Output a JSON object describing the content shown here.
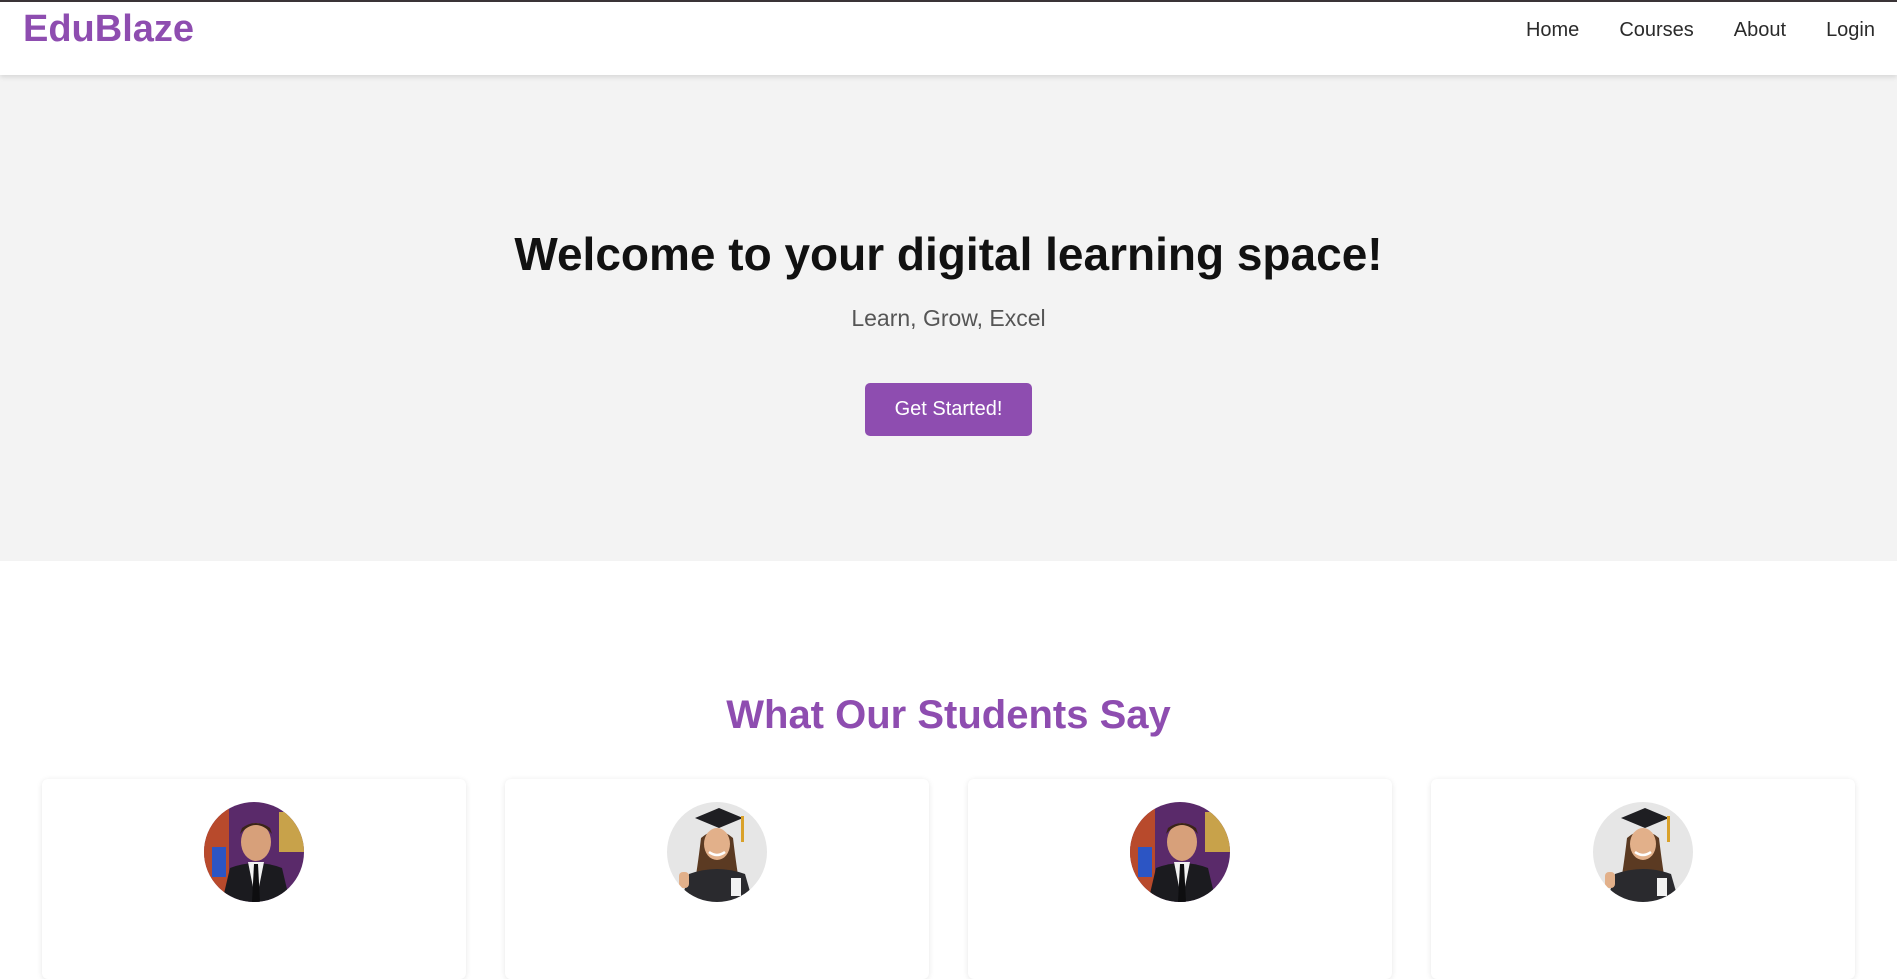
{
  "header": {
    "brand": "EduBlaze",
    "nav": {
      "home": "Home",
      "courses": "Courses",
      "about": "About",
      "login": "Login"
    }
  },
  "hero": {
    "title": "Welcome to your digital learning space!",
    "subtitle": "Learn, Grow, Excel",
    "cta_label": "Get Started!"
  },
  "testimonials": {
    "title": "What Our Students Say",
    "cards": [
      {
        "avatar": "male-student-portrait"
      },
      {
        "avatar": "female-graduate-portrait"
      },
      {
        "avatar": "male-student-portrait"
      },
      {
        "avatar": "female-graduate-portrait"
      }
    ]
  },
  "colors": {
    "brand": "#8e4db0",
    "hero_bg": "#f3f3f3",
    "text": "#111111",
    "muted": "#555555"
  }
}
